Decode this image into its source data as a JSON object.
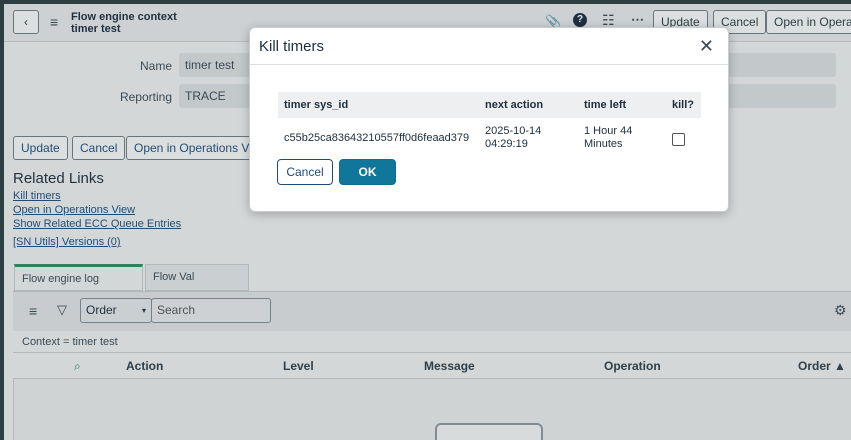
{
  "header": {
    "title_line1": "Flow engine context",
    "title_line2": "timer test",
    "buttons": {
      "update": "Update",
      "cancel": "Cancel",
      "open_ops": "Open in Operat"
    }
  },
  "form": {
    "name_label": "Name",
    "name_value": "timer test",
    "reporting_label": "Reporting",
    "reporting_value": "TRACE"
  },
  "bottom_buttons": {
    "update": "Update",
    "cancel": "Cancel",
    "open_ops": "Open in Operations Vie"
  },
  "related_links": {
    "title": "Related Links",
    "items": [
      "Kill timers",
      "Open in Operations View",
      "Show Related ECC Queue Entries",
      "[SN Utils] Versions (0)"
    ]
  },
  "tabs": [
    "Flow engine log entries",
    "Flow Val Listeners"
  ],
  "list": {
    "select_value": "Order",
    "search_placeholder": "Search",
    "breadcrumb": "Context = timer test",
    "columns": [
      "Action",
      "Level",
      "Message",
      "Operation",
      "Order ▲"
    ]
  },
  "modal": {
    "title": "Kill timers",
    "close": "✕",
    "columns": [
      "timer sys_id",
      "next action",
      "time left",
      "kill?"
    ],
    "row": {
      "sys_id": "c55b25ca83643210557ff0d6feaad379",
      "next_action_line1": "2025-10-14",
      "next_action_line2": "04:29:19",
      "time_left_line1": "1 Hour 44",
      "time_left_line2": "Minutes",
      "kill_checked": false
    },
    "cancel": "Cancel",
    "ok": "OK"
  },
  "icons": {
    "back": "chevron-left-icon",
    "menu": "hamburger-icon",
    "attach": "paperclip-icon",
    "help": "question-icon",
    "settings": "sliders-icon",
    "more": "ellipsis-icon",
    "filter": "funnel-icon",
    "gear": "gear-icon",
    "search_col": "search-icon"
  }
}
